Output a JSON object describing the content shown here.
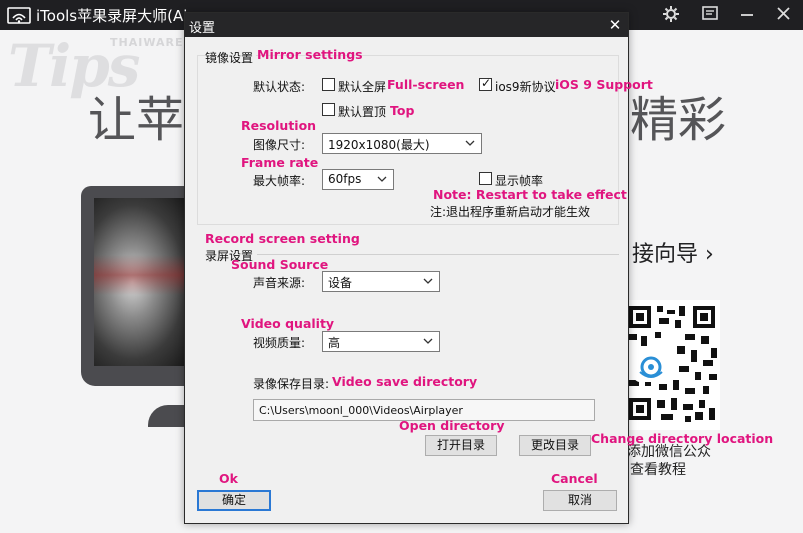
{
  "app": {
    "title": "iTools苹果录屏大师(Ai",
    "watermark": "Tips",
    "watermark_sub": "THAIWARE",
    "hero_left": "让苹",
    "hero_right": "精彩",
    "connect_guide": "接向导 ›",
    "qr_caption_line1": "添加微信公众",
    "qr_caption_line2": "查看教程"
  },
  "dialog": {
    "title": "设置",
    "close_glyph": "✕",
    "mirror_section": {
      "label": "镜像设置",
      "annotation": "Mirror settings"
    },
    "default_state": {
      "label": "默认状态:",
      "fullscreen": {
        "label": "默认全屏",
        "annotation": "Full-screen",
        "checked": false
      },
      "ios9": {
        "label": "ios9新协议",
        "annotation": "iOS 9 Support",
        "checked": true
      },
      "top": {
        "label": "默认置顶",
        "annotation": "Top",
        "checked": false
      }
    },
    "resolution": {
      "annotation": "Resolution",
      "label": "图像尺寸:",
      "value": "1920x1080(最大)"
    },
    "frame_rate": {
      "annotation": "Frame rate",
      "label": "最大帧率:",
      "value": "60fps",
      "show_fps": {
        "label": "显示帧率",
        "checked": false
      }
    },
    "note": {
      "annotation": "Note: Restart to take effect",
      "text": "注:退出程序重新启动才能生效"
    },
    "record_section": {
      "annotation": "Record screen setting",
      "label": "录屏设置"
    },
    "sound_source": {
      "annotation": "Sound Source",
      "label": "声音来源:",
      "value": "设备"
    },
    "video_quality": {
      "annotation": "Video quality",
      "label": "视频质量:",
      "value": "高"
    },
    "save_dir": {
      "label": "录像保存目录:",
      "annotation": "Video save directory",
      "path": "C:\\Users\\moonl_000\\Videos\\Airplayer"
    },
    "open_dir": {
      "annotation": "Open directory",
      "label": "打开目录"
    },
    "change_dir": {
      "annotation": "Change directory location",
      "label": "更改目录"
    },
    "ok": {
      "annotation": "Ok",
      "label": "确定"
    },
    "cancel": {
      "annotation": "Cancel",
      "label": "取消"
    }
  },
  "colors": {
    "annotation": "#e0157f",
    "titlebar": "#1f1f22",
    "dialog_bg": "#f0f0f0",
    "default_button_border": "#2a78d4"
  }
}
